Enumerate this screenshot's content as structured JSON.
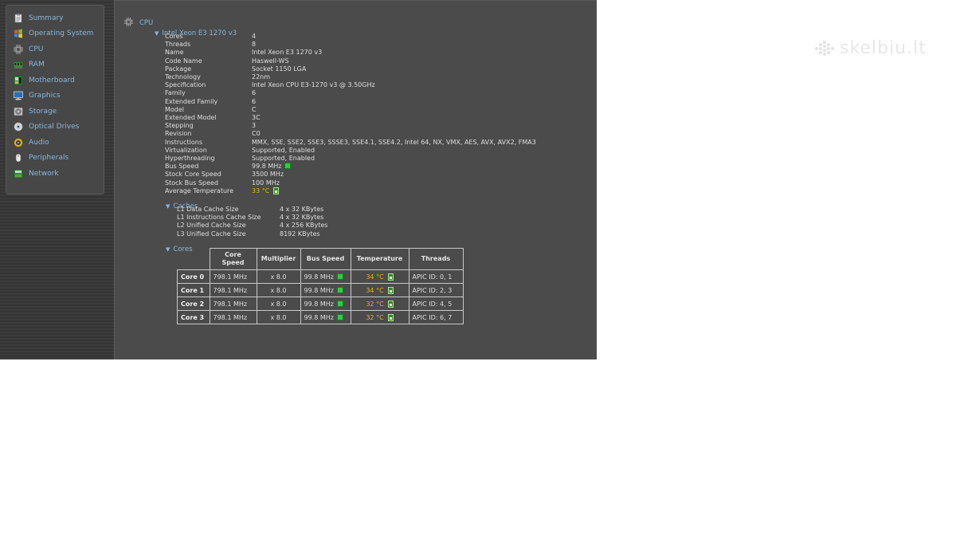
{
  "sidebar": {
    "items": [
      {
        "label": "Summary",
        "icon": "summary-icon"
      },
      {
        "label": "Operating System",
        "icon": "windows-icon"
      },
      {
        "label": "CPU",
        "icon": "cpu-icon"
      },
      {
        "label": "RAM",
        "icon": "ram-icon"
      },
      {
        "label": "Motherboard",
        "icon": "motherboard-icon"
      },
      {
        "label": "Graphics",
        "icon": "monitor-icon"
      },
      {
        "label": "Storage",
        "icon": "disk-icon"
      },
      {
        "label": "Optical Drives",
        "icon": "optical-disc-icon"
      },
      {
        "label": "Audio",
        "icon": "speaker-icon"
      },
      {
        "label": "Peripherals",
        "icon": "mouse-icon"
      },
      {
        "label": "Network",
        "icon": "network-icon"
      }
    ]
  },
  "main": {
    "section_title": "CPU",
    "processor_title": "Intel Xeon E3 1270 v3",
    "properties": [
      {
        "label": "Cores",
        "value": "4"
      },
      {
        "label": "Threads",
        "value": "8"
      },
      {
        "label": "Name",
        "value": "Intel Xeon E3 1270 v3"
      },
      {
        "label": "Code Name",
        "value": "Haswell-WS"
      },
      {
        "label": "Package",
        "value": "Socket 1150 LGA"
      },
      {
        "label": "Technology",
        "value": "22nm"
      },
      {
        "label": "Specification",
        "value": "Intel Xeon CPU E3-1270 v3 @ 3.50GHz"
      },
      {
        "label": "Family",
        "value": "6"
      },
      {
        "label": "Extended Family",
        "value": "6"
      },
      {
        "label": "Model",
        "value": "C"
      },
      {
        "label": "Extended Model",
        "value": "3C"
      },
      {
        "label": "Stepping",
        "value": "3"
      },
      {
        "label": "Revision",
        "value": "C0"
      },
      {
        "label": "Instructions",
        "value": "MMX, SSE, SSE2, SSE3, SSSE3, SSE4.1, SSE4.2, Intel 64, NX, VMX, AES, AVX, AVX2, FMA3"
      },
      {
        "label": "Virtualization",
        "value": "Supported, Enabled"
      },
      {
        "label": "Hyperthreading",
        "value": "Supported, Enabled"
      },
      {
        "label": "Bus Speed",
        "value": "99.8 MHz"
      },
      {
        "label": "Stock Core Speed",
        "value": "3500 MHz"
      },
      {
        "label": "Stock Bus Speed",
        "value": "100 MHz"
      },
      {
        "label": "Average Temperature",
        "value": "33 °C"
      }
    ],
    "caches_title": "Caches",
    "caches": [
      {
        "label": "L1 Data Cache Size",
        "value": "4 x 32 KBytes"
      },
      {
        "label": "L1 Instructions Cache Size",
        "value": "4 x 32 KBytes"
      },
      {
        "label": "L2 Unified Cache Size",
        "value": "4 x 256 KBytes"
      },
      {
        "label": "L3 Unified Cache Size",
        "value": "8192 KBytes"
      }
    ],
    "cores_title": "Cores",
    "cores_table": {
      "headers": [
        "Core Speed",
        "Multiplier",
        "Bus Speed",
        "Temperature",
        "Threads"
      ],
      "rows": [
        {
          "core": "Core 0",
          "speed": "798.1 MHz",
          "multiplier": "x 8.0",
          "bus": "99.8 MHz",
          "temp": "34 °C",
          "threads": "APIC ID: 0, 1"
        },
        {
          "core": "Core 1",
          "speed": "798.1 MHz",
          "multiplier": "x 8.0",
          "bus": "99.8 MHz",
          "temp": "34 °C",
          "threads": "APIC ID: 2, 3"
        },
        {
          "core": "Core 2",
          "speed": "798.1 MHz",
          "multiplier": "x 8.0",
          "bus": "99.8 MHz",
          "temp": "32 °C",
          "threads": "APIC ID: 4, 5"
        },
        {
          "core": "Core 3",
          "speed": "798.1 MHz",
          "multiplier": "x 8.0",
          "bus": "99.8 MHz",
          "temp": "32 °C",
          "threads": "APIC ID: 6, 7"
        }
      ]
    }
  },
  "watermark": {
    "text": "skelbiu.lt"
  },
  "colors": {
    "accent": "#86b7df",
    "temperature": "#e8b21f",
    "indicator": "#2ecc40"
  }
}
